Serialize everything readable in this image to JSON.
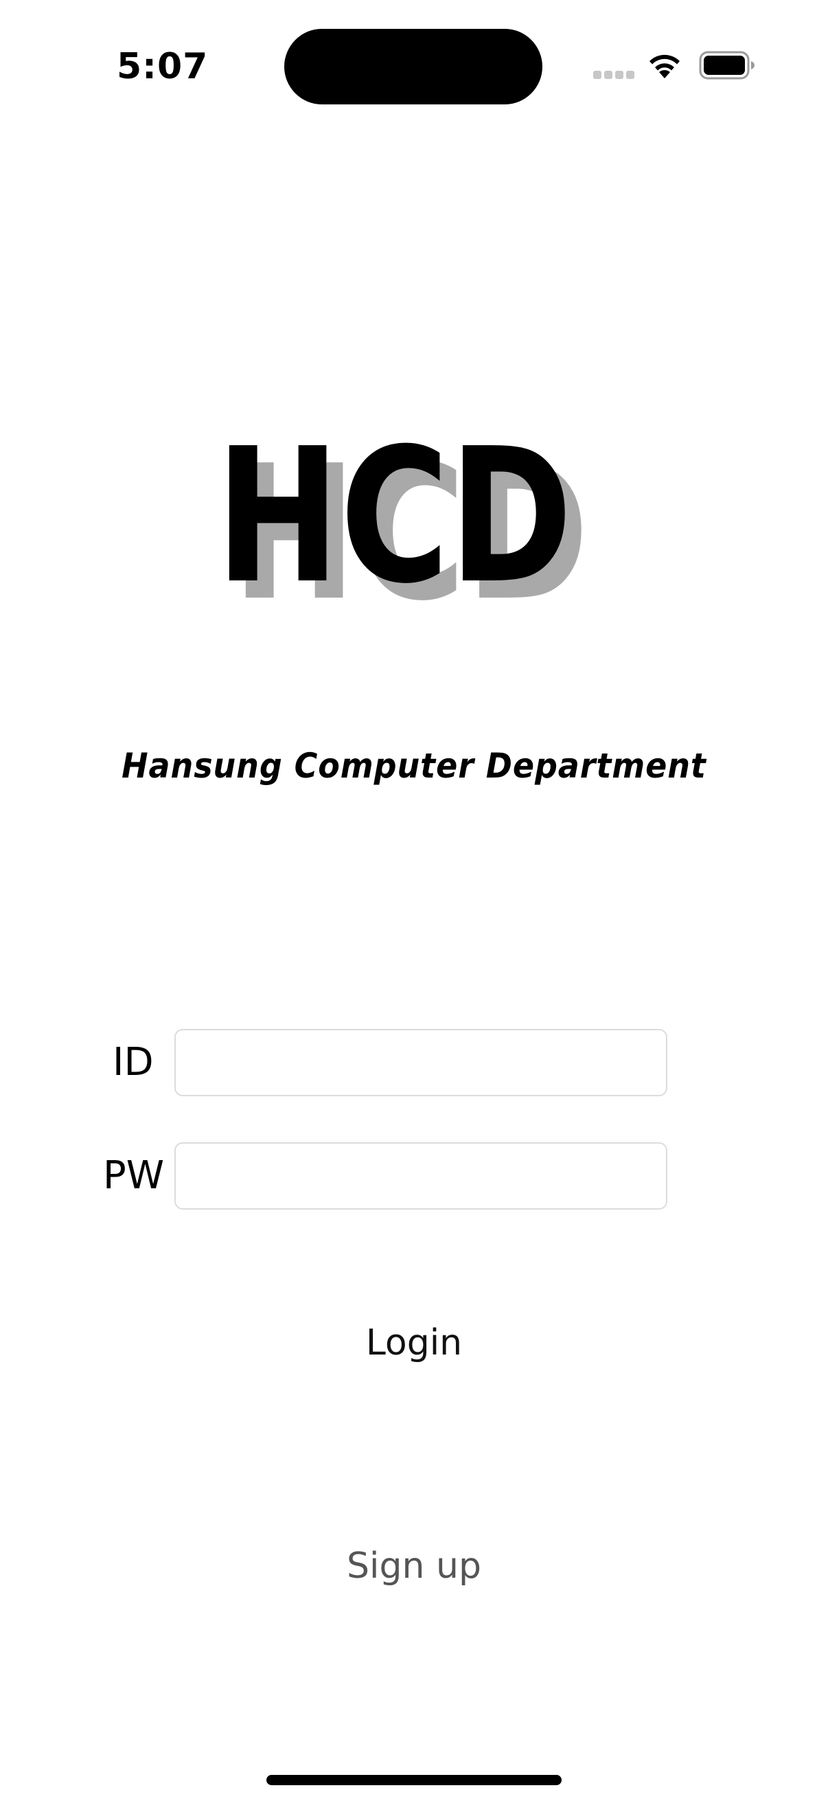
{
  "status_bar": {
    "time": "5:07",
    "icons": [
      "cellular-signal-icon",
      "wifi-icon",
      "battery-icon"
    ]
  },
  "logo": {
    "text": "HCD",
    "fill_color": "#000000",
    "shadow_color": "#a9a9a9"
  },
  "subtitle": "Hansung Computer Department",
  "form": {
    "id_label": "ID",
    "id_value": "",
    "pw_label": "PW",
    "pw_value": "",
    "field_border_color": "#dcdcdc"
  },
  "buttons": {
    "login_label": "Login",
    "signup_label": "Sign up",
    "signup_color": "#555555"
  }
}
